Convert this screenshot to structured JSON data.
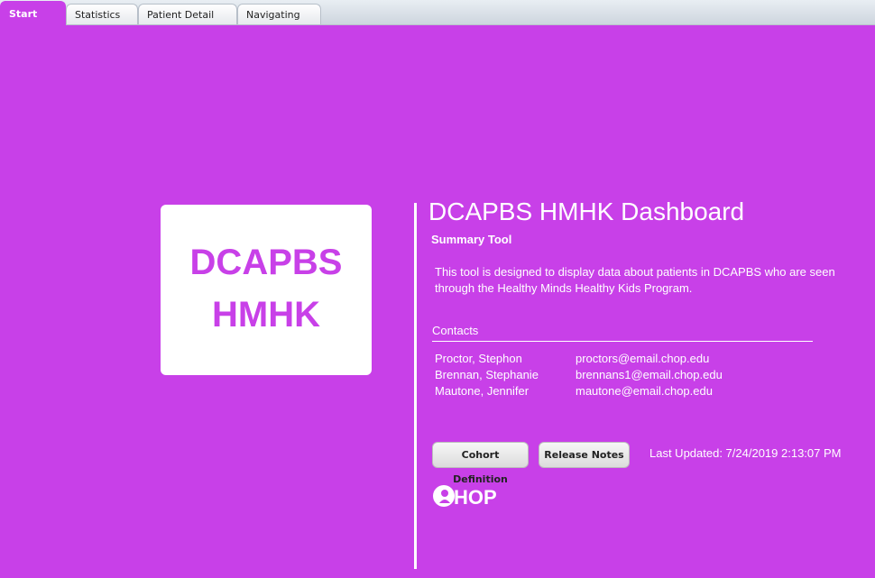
{
  "tabs": [
    {
      "label": "Start",
      "active": true
    },
    {
      "label": "Statistics",
      "active": false
    },
    {
      "label": "Patient Detail",
      "active": false
    },
    {
      "label": "Navigating",
      "active": false
    }
  ],
  "logo": {
    "line1": "DCAPBS",
    "line2": "HMHK"
  },
  "header": {
    "title": "DCAPBS HMHK Dashboard",
    "subtitle": "Summary Tool",
    "description": "This tool is designed to display data about patients in DCAPBS who are seen through the Healthy Minds Healthy Kids Program."
  },
  "contacts": {
    "heading": "Contacts",
    "people": [
      {
        "name": "Proctor, Stephon",
        "email": "proctors@email.chop.edu"
      },
      {
        "name": "Brennan, Stephanie",
        "email": "brennans1@email.chop.edu"
      },
      {
        "name": "Mautone, Jennifer",
        "email": "mautone@email.chop.edu"
      }
    ]
  },
  "buttons": {
    "cohort": "Cohort Definition",
    "release": "Release Notes"
  },
  "last_updated": "Last Updated: 7/24/2019 2:13:07 PM",
  "brand": {
    "chop_text": "CHOP",
    "icon": "chop-logo"
  },
  "colors": {
    "background": "#c840e8",
    "text": "#ffffff",
    "card": "#ffffff"
  }
}
